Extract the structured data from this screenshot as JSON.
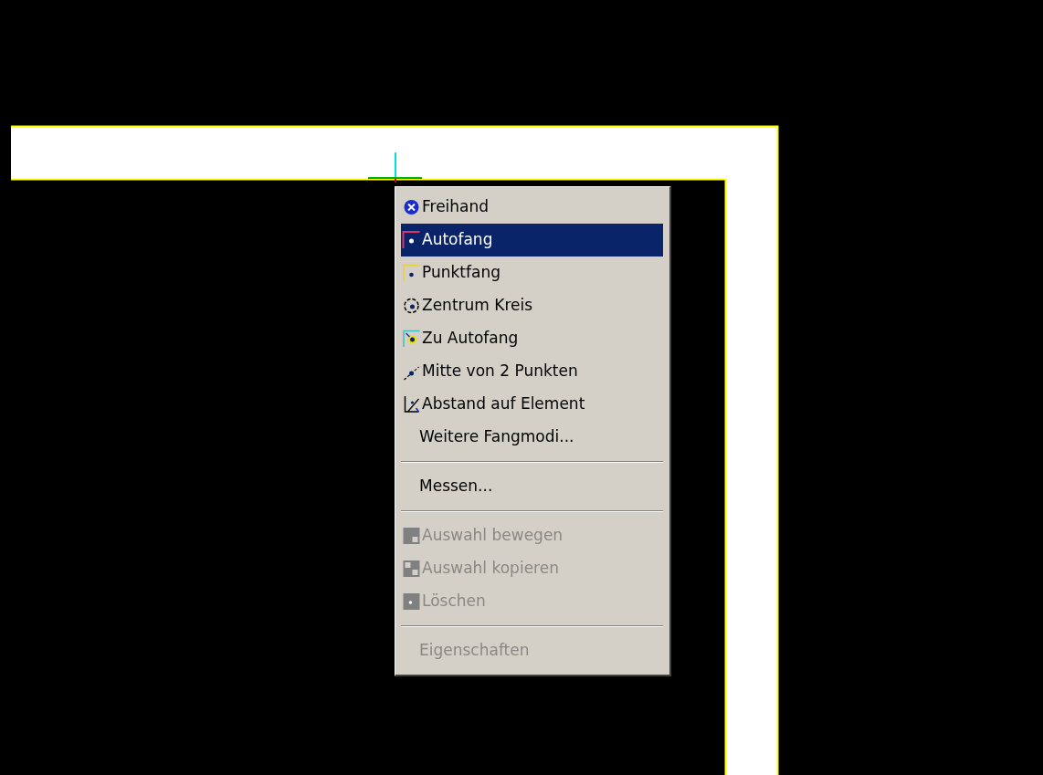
{
  "context_menu": {
    "items": [
      {
        "kind": "item",
        "label": "Freihand",
        "selected": false,
        "disabled": false
      },
      {
        "kind": "item",
        "label": "Autofang",
        "selected": true,
        "disabled": false
      },
      {
        "kind": "item",
        "label": "Punktfang",
        "selected": false,
        "disabled": false
      },
      {
        "kind": "item",
        "label": "Zentrum Kreis",
        "selected": false,
        "disabled": false
      },
      {
        "kind": "item",
        "label": "Zu Autofang",
        "selected": false,
        "disabled": false
      },
      {
        "kind": "item",
        "label": "Mitte von 2 Punkten",
        "selected": false,
        "disabled": false
      },
      {
        "kind": "item",
        "label": "Abstand auf Element",
        "selected": false,
        "disabled": false
      },
      {
        "kind": "item",
        "label": "Weitere Fangmodi...",
        "selected": false,
        "disabled": false
      },
      {
        "kind": "separator"
      },
      {
        "kind": "item",
        "label": "Messen...",
        "selected": false,
        "disabled": false
      },
      {
        "kind": "separator"
      },
      {
        "kind": "item",
        "label": "Auswahl bewegen",
        "selected": false,
        "disabled": true
      },
      {
        "kind": "item",
        "label": "Auswahl kopieren",
        "selected": false,
        "disabled": true
      },
      {
        "kind": "item",
        "label": "Löschen",
        "selected": false,
        "disabled": true
      },
      {
        "kind": "separator"
      },
      {
        "kind": "item",
        "label": "Eigenschaften",
        "selected": false,
        "disabled": true
      }
    ]
  }
}
